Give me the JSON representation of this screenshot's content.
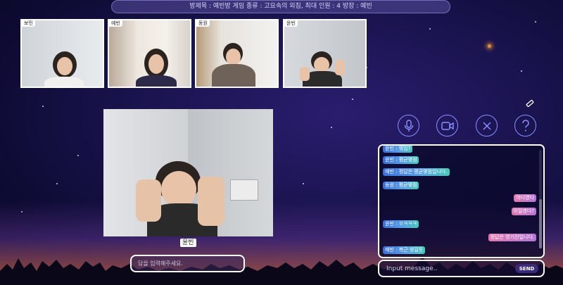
{
  "room": {
    "banner": "방제목 : 예빈방   게임 종류 : 고요속의 외침, 최대 인원 : 4   방장 : 예빈"
  },
  "participants": [
    {
      "name": "보민"
    },
    {
      "name": "예빈"
    },
    {
      "name": "동원"
    },
    {
      "name": "윤빈"
    }
  ],
  "main_video": {
    "name": "윤빈"
  },
  "answer_input": {
    "placeholder": "답을 입력해주세요."
  },
  "controls": [
    {
      "icon": "microphone-icon"
    },
    {
      "icon": "camera-icon"
    },
    {
      "icon": "close-icon"
    },
    {
      "icon": "help-icon"
    }
  ],
  "chat": {
    "messages": [
      {
        "side": "left",
        "text": "윤빈 : 뭐임?"
      },
      {
        "side": "left",
        "text": "윤빈 : 평균몇점"
      },
      {
        "side": "left",
        "text": "예빈 : 정답은 평균몇점입니다."
      },
      {
        "side": "left",
        "text": "동원 : 평균몇점"
      },
      {
        "side": "right",
        "text": "어디였다"
      },
      {
        "side": "right",
        "text": "이일겐다?"
      },
      {
        "side": "left",
        "text": "윤빈 : ㅇㅋㅋㅋ"
      },
      {
        "side": "right",
        "text": "정답은 영기전입니다."
      },
      {
        "side": "left",
        "text": "예빈 : 복근 생길듯"
      }
    ],
    "input_placeholder": "Input message..",
    "send_label": "SEND"
  },
  "colors": {
    "accent": "#8a90ff",
    "send": "#3b2a7a"
  }
}
